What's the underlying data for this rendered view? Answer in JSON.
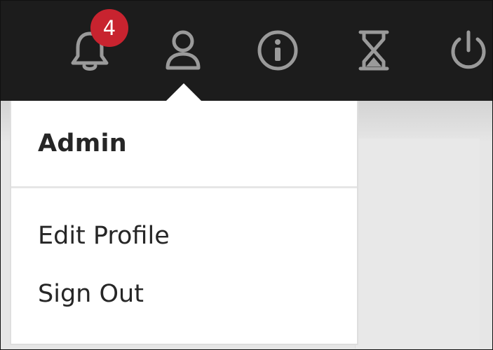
{
  "toolbar": {
    "notifications": {
      "icon": "bell-icon",
      "badge_count": "4",
      "badge_color": "#c8232f"
    },
    "user": {
      "icon": "user-icon"
    },
    "info": {
      "icon": "info-icon"
    },
    "timer": {
      "icon": "hourglass-icon"
    },
    "power": {
      "icon": "power-icon"
    },
    "background_color": "#1c1c1c",
    "icon_color": "#9a9a9a"
  },
  "user_menu": {
    "title": "Admin",
    "items": [
      {
        "label": "Edit Profile"
      },
      {
        "label": "Sign Out"
      }
    ]
  }
}
